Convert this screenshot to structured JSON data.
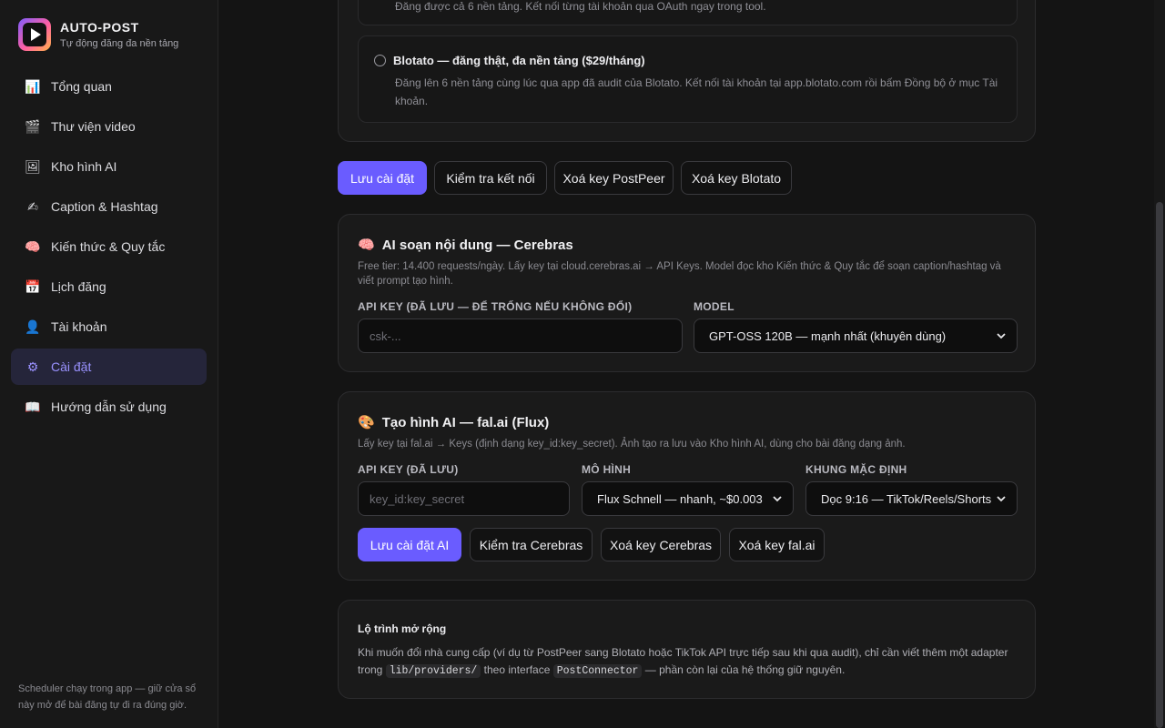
{
  "app": {
    "name": "AUTO-POST",
    "subtitle": "Tự động đăng đa nền tảng"
  },
  "sidebar": {
    "items": [
      {
        "label": "Tổng quan",
        "icon": "chart-icon",
        "glyph": "📊"
      },
      {
        "label": "Thư viện video",
        "icon": "clapper-icon",
        "glyph": "🎬"
      },
      {
        "label": "Kho hình AI",
        "icon": "picture-icon",
        "glyph": "🖼"
      },
      {
        "label": "Caption & Hashtag",
        "icon": "writing-hand-icon",
        "glyph": "✍"
      },
      {
        "label": "Kiến thức & Quy tắc",
        "icon": "brain-icon",
        "glyph": "🧠"
      },
      {
        "label": "Lịch đăng",
        "icon": "calendar-icon",
        "glyph": "📅"
      },
      {
        "label": "Tài khoản",
        "icon": "user-icon",
        "glyph": "👤"
      },
      {
        "label": "Cài đặt",
        "icon": "gear-icon",
        "glyph": "⚙"
      },
      {
        "label": "Hướng dẫn sử dụng",
        "icon": "book-icon",
        "glyph": "📖"
      }
    ],
    "active_label": "Cài đặt",
    "footer": "Scheduler chạy trong app — giữ cửa sổ này mở để bài đăng tự đi ra đúng giờ."
  },
  "providers": {
    "option1_desc": "Đăng được cả 6 nền tảng. Kết nối từng tài khoản qua OAuth ngay trong tool.",
    "option2_title": "Blotato — đăng thật, đa nền tảng ($29/tháng)",
    "option2_desc": "Đăng lên 6 nền tảng cùng lúc qua app đã audit của Blotato. Kết nối tài khoản tại app.blotato.com rồi bấm Đồng bộ ở mục Tài khoản."
  },
  "actions": {
    "save": "Lưu cài đặt",
    "test": "Kiểm tra kết nối",
    "clear_postpeer": "Xoá key PostPeer",
    "clear_blotato": "Xoá key Blotato"
  },
  "cerebras": {
    "title": "AI soạn nội dung — Cerebras",
    "emoji": "🧠",
    "desc": "Free tier: 14.400 requests/ngày. Lấy key tại cloud.cerebras.ai → API Keys. Model đọc kho Kiến thức & Quy tắc để soạn caption/hashtag và viết prompt tạo hình.",
    "api_label": "API KEY (ĐÃ LƯU — ĐỂ TRỐNG NẾU KHÔNG ĐỔI)",
    "api_placeholder": "csk-...",
    "model_label": "MODEL",
    "model_value": "GPT-OSS 120B — mạnh nhất (khuyên dùng)"
  },
  "fal": {
    "title": "Tạo hình AI — fal.ai (Flux)",
    "emoji": "🎨",
    "desc": "Lấy key tại fal.ai → Keys (định dạng key_id:key_secret). Ảnh tạo ra lưu vào Kho hình AI, dùng cho bài đăng dạng ảnh.",
    "api_label": "API KEY (ĐÃ LƯU)",
    "api_placeholder": "key_id:key_secret",
    "model_label": "MÔ HÌNH",
    "model_value": "Flux Schnell — nhanh, ~$0.003",
    "frame_label": "KHUNG MẶC ĐỊNH",
    "frame_value": "Dọc 9:16 — TikTok/Reels/Shorts",
    "btn_save_ai": "Lưu cài đặt AI",
    "btn_test_cerebras": "Kiểm tra Cerebras",
    "btn_clear_cerebras": "Xoá key Cerebras",
    "btn_clear_fal": "Xoá key fal.ai"
  },
  "roadmap": {
    "title": "Lộ trình mở rộng",
    "text_1": "Khi muốn đổi nhà cung cấp (ví dụ từ PostPeer sang Blotato hoặc TikTok API trực tiếp sau khi qua audit), chỉ cần viết thêm một adapter trong",
    "code_1": "lib/providers/",
    "text_2": "theo interface",
    "code_2": "PostConnector",
    "text_3": "— phần còn lại của hệ thống giữ nguyên."
  },
  "colors": {
    "accent": "#6a5cff",
    "active_nav_bg": "#25253a",
    "active_nav_text": "#9a92ff"
  }
}
